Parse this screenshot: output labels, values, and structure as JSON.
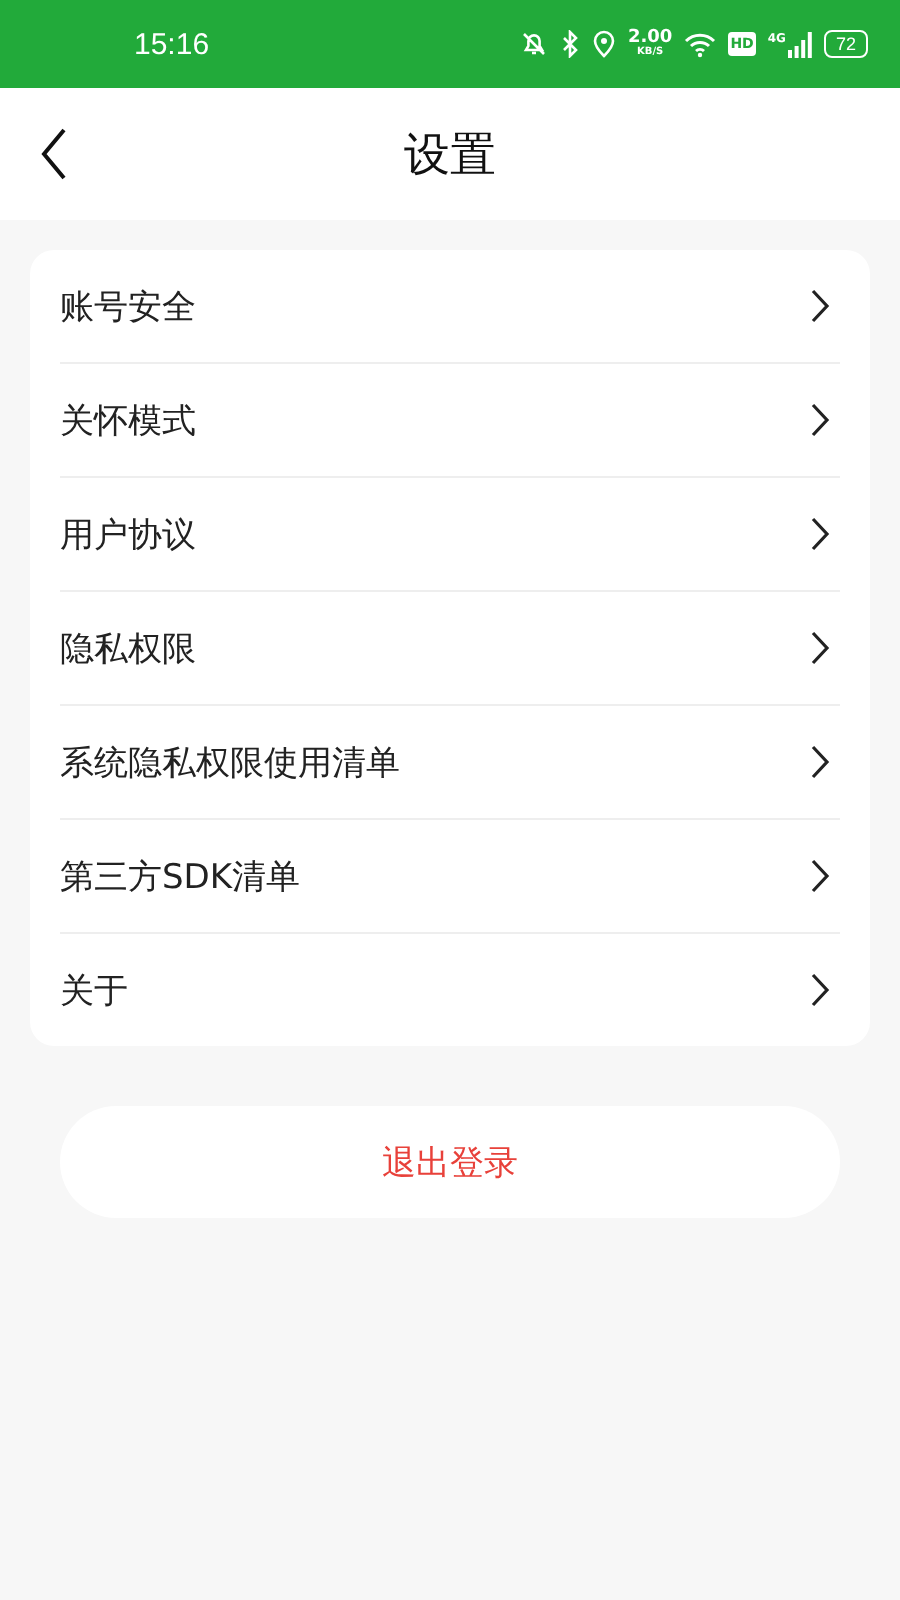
{
  "status_bar": {
    "time": "15:16",
    "speed": "2.00",
    "speed_unit": "KB/S",
    "hd": "HD",
    "network": "4G",
    "battery": "72"
  },
  "header": {
    "title": "设置"
  },
  "settings": [
    {
      "label": "账号安全"
    },
    {
      "label": "关怀模式"
    },
    {
      "label": "用户协议"
    },
    {
      "label": "隐私权限"
    },
    {
      "label": "系统隐私权限使用清单"
    },
    {
      "label": "第三方SDK清单"
    },
    {
      "label": "关于"
    }
  ],
  "logout_button": "退出登录"
}
